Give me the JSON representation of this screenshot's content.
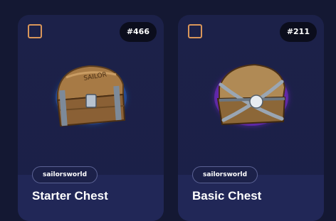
{
  "cards": [
    {
      "id_label": "#466",
      "creator": "sailorsworld",
      "title": "Starter Chest",
      "glow_color": "#2f6fd6",
      "icon": "treasure-chest-icon"
    },
    {
      "id_label": "#211",
      "creator": "sailorsworld",
      "title": "Basic Chest",
      "glow_color": "#8a2be2",
      "icon": "chained-chest-icon"
    }
  ],
  "colors": {
    "background": "#141833",
    "card": "#1c2149",
    "checkbox_border": "#d9965a"
  }
}
